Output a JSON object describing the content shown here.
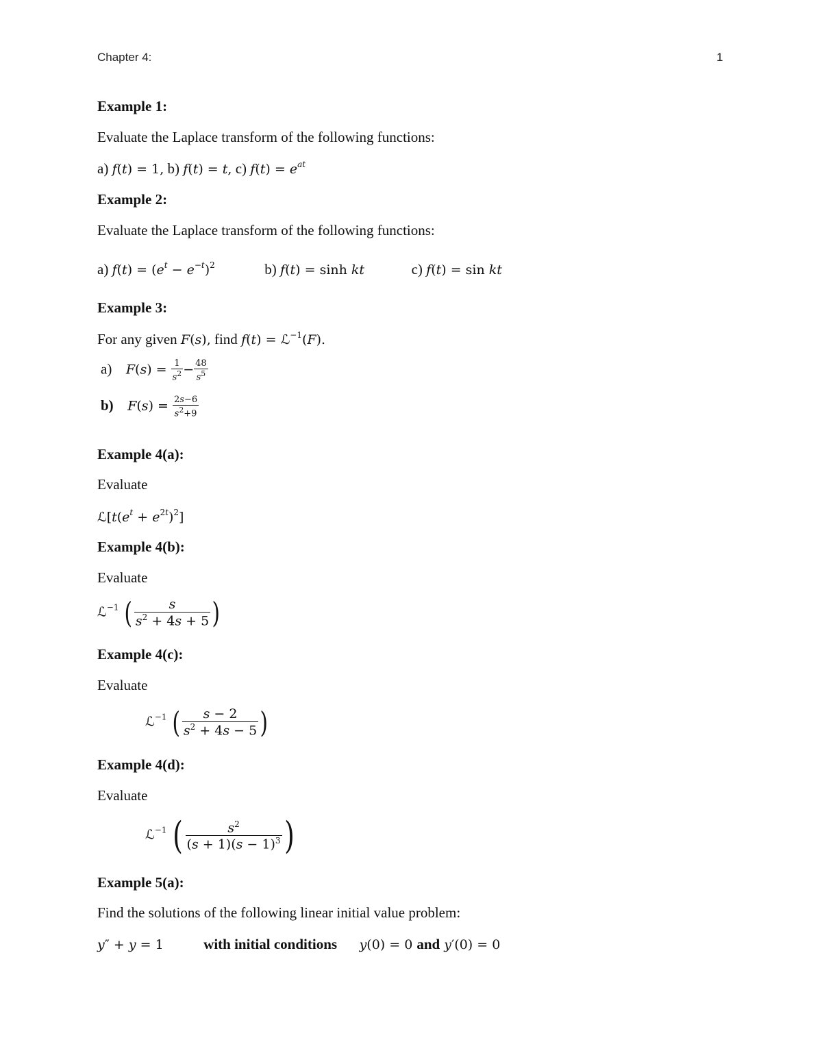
{
  "header": {
    "chapter": "Chapter 4:",
    "page_number": "1"
  },
  "examples": [
    {
      "title": "Example 1:",
      "prompt": "Evaluate the Laplace transform of the following functions:",
      "items": [
        "a) f(t) = 1,",
        "b) f(t) = t,",
        "c) f(t) = e^{at}"
      ]
    },
    {
      "title": "Example 2:",
      "prompt": "Evaluate the Laplace transform of the following functions:",
      "items": [
        "a) f(t) = (e^t − e^{−t})^2",
        "b) f(t) = sinh kt",
        "c) f(t) = sin kt"
      ]
    },
    {
      "title": "Example 3:",
      "prompt": "For any given F(s), find f(t) = ℒ^{−1}(F).",
      "items": [
        "a) F(s) = 1/s^2 − 48/s^5",
        "b) F(s) = (2s−6)/(s^2+9)"
      ]
    },
    {
      "title": "Example 4(a):",
      "prompt": "Evaluate",
      "expression": "ℒ[t(e^t + e^{2t})^2]"
    },
    {
      "title": "Example 4(b):",
      "prompt": "Evaluate",
      "expression": "ℒ^{−1}( s / (s^2 + 4s + 5) )"
    },
    {
      "title": "Example 4(c):",
      "prompt": "Evaluate",
      "expression": "ℒ^{−1}( (s − 2) / (s^2 + 4s − 5) )"
    },
    {
      "title": "Example 4(d):",
      "prompt": "Evaluate",
      "expression": "ℒ^{−1}( s^2 / ((s + 1)(s − 1)^3) )"
    },
    {
      "title": "Example 5(a):",
      "prompt": "Find the solutions of the following linear initial value problem:",
      "equation": "y'' + y = 1",
      "conditions_label": "with initial conditions",
      "conditions": "y(0) = 0 and y'(0) = 0"
    }
  ],
  "labels": {
    "a": "a)",
    "b": "b)",
    "c": "c)",
    "and": "and",
    "find": "find",
    "for_any_given": "For any given",
    "laplace": "ℒ",
    "inv": "−1"
  }
}
